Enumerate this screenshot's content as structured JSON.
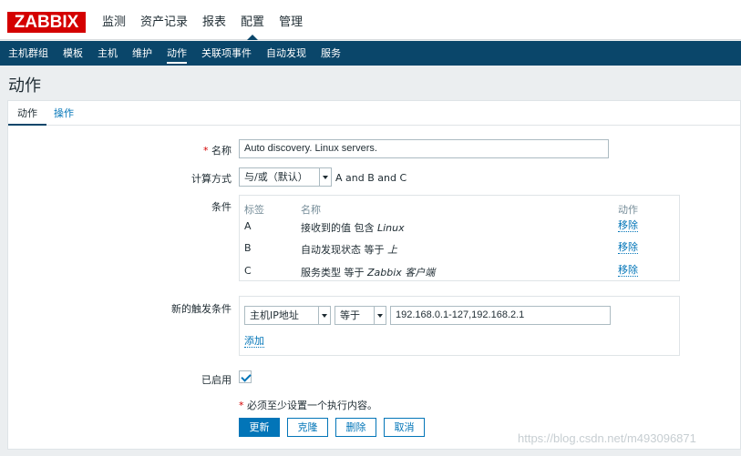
{
  "header": {
    "logo": "ZABBIX",
    "nav": [
      "监测",
      "资产记录",
      "报表",
      "配置",
      "管理"
    ],
    "active_nav": "配置"
  },
  "subnav": [
    "主机群组",
    "模板",
    "主机",
    "维护",
    "动作",
    "关联项事件",
    "自动发现",
    "服务"
  ],
  "page_title": "动作",
  "tabs": {
    "action": "动作",
    "operations": "操作"
  },
  "form": {
    "name_label": "名称",
    "name_value": "Auto discovery. Linux servers.",
    "calc_label": "计算方式",
    "calc_value": "与/或（默认）",
    "calc_expression": "A and B and C",
    "conditions_label": "条件",
    "conditions_headers": {
      "label": "标签",
      "name": "名称",
      "action": "动作"
    },
    "conditions": [
      {
        "label": "A",
        "prefix": "接收到的值 包含 ",
        "value": "Linux",
        "action": "移除"
      },
      {
        "label": "B",
        "prefix": "自动发现状态 等于 ",
        "value": "上",
        "action": "移除"
      },
      {
        "label": "C",
        "prefix": "服务类型 等于 ",
        "value": "Zabbix 客户端",
        "action": "移除"
      }
    ],
    "new_condition_label": "新的触发条件",
    "new_condition_type": "主机IP地址",
    "new_condition_operator": "等于",
    "new_condition_value": "192.168.0.1-127,192.168.2.1",
    "add_link": "添加",
    "enabled_label": "已启用",
    "enabled": true,
    "required_note": "必须至少设置一个执行内容。"
  },
  "buttons": {
    "update": "更新",
    "clone": "克隆",
    "delete": "删除",
    "cancel": "取消"
  },
  "watermark": "https://blog.csdn.net/m493096871",
  "colors": {
    "brand": "#d40000",
    "nav_bg": "#0a466a",
    "link": "#0275b8"
  }
}
